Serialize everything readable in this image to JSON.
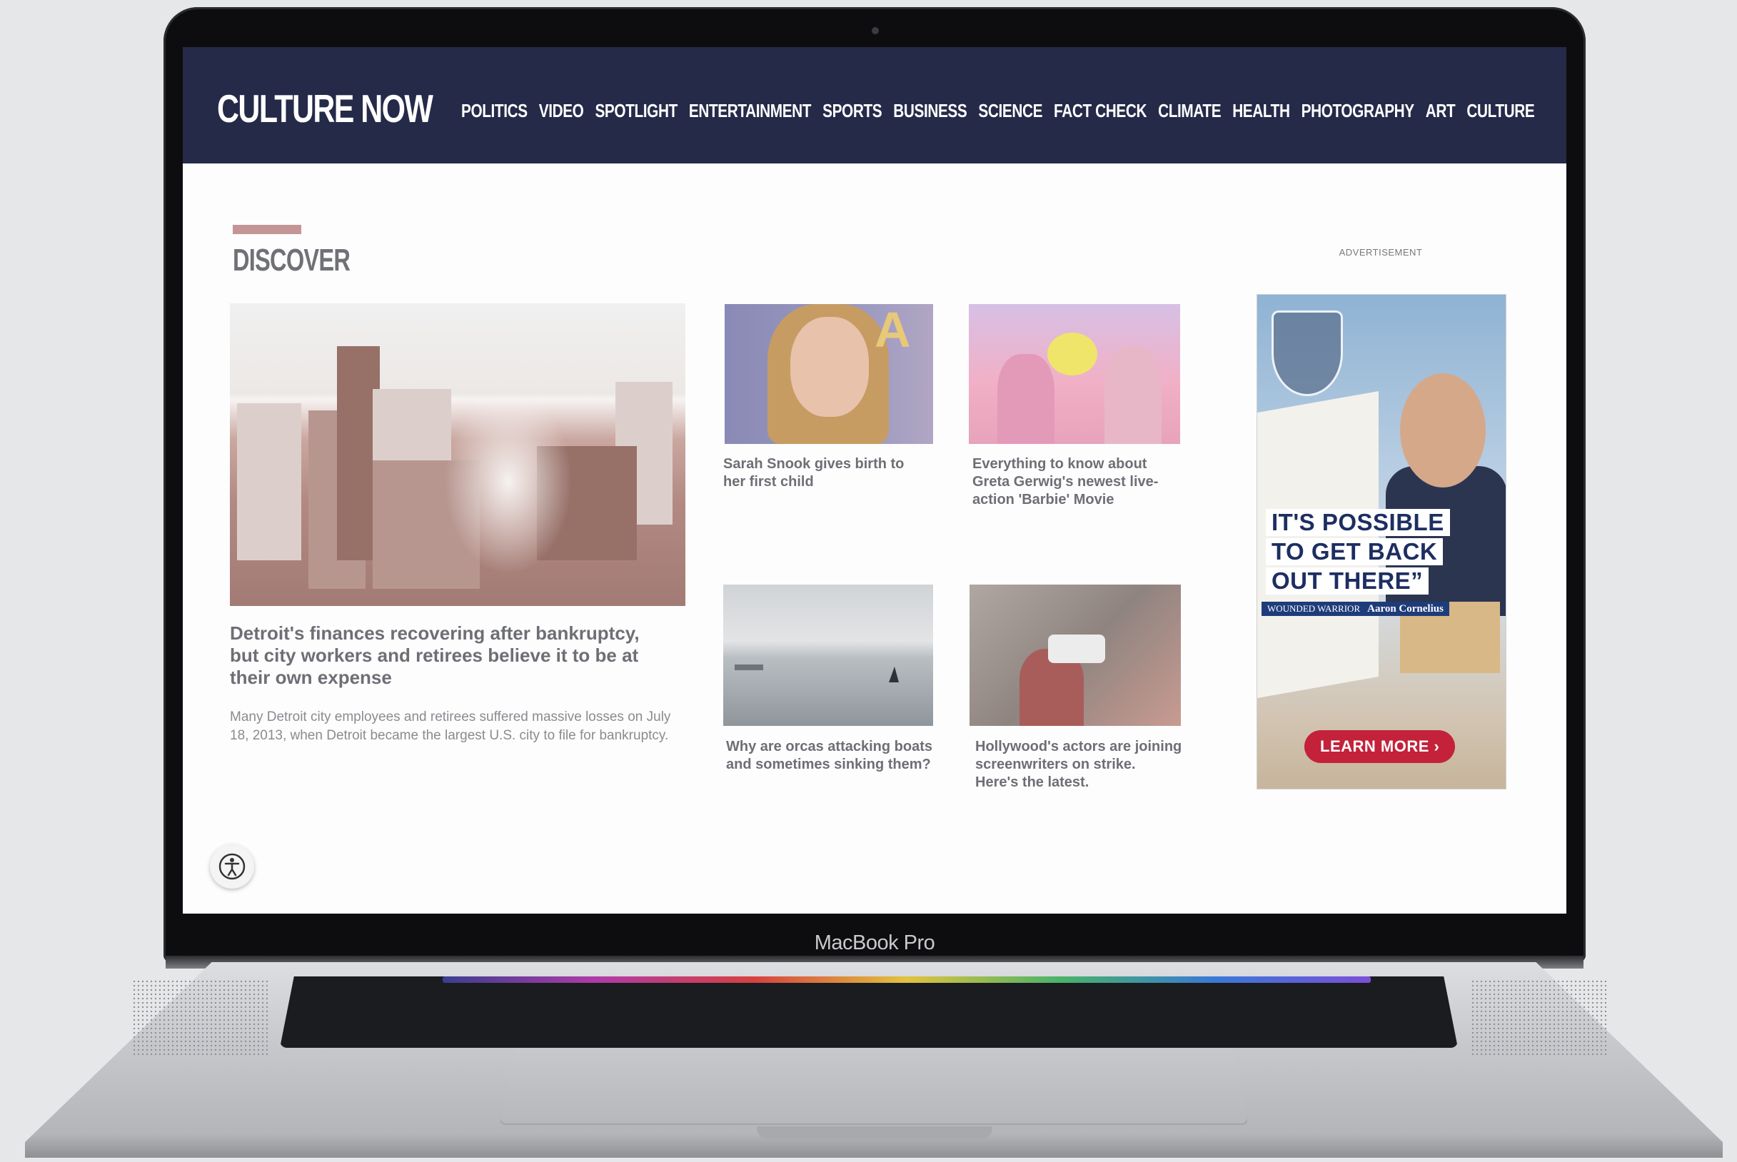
{
  "device": {
    "label": "MacBook Pro"
  },
  "site": {
    "logo": "CULTURE NOW",
    "nav": [
      "POLITICS",
      "VIDEO",
      "SPOTLIGHT",
      "ENTERTAINMENT",
      "SPORTS",
      "BUSINESS",
      "SCIENCE",
      "FACT CHECK",
      "CLIMATE",
      "HEALTH",
      "PHOTOGRAPHY",
      "ART",
      "CULTURE"
    ],
    "colors": {
      "header": "#252a49",
      "accent": "#c49595",
      "ad_button": "#c3223a"
    }
  },
  "discover": {
    "title": "DISCOVER",
    "feature": {
      "headline": "Detroit's finances recovering after bankruptcy, but city workers and retirees believe it to be at their own expense",
      "summary": "Many Detroit city employees and retirees suffered massive losses on July 18, 2013, when Detroit became the largest U.S. city to file for bankruptcy."
    },
    "cards": [
      {
        "title": "Sarah Snook gives birth to her first child"
      },
      {
        "title": "Everything to know about Greta Gerwig's newest live-action 'Barbie' Movie"
      },
      {
        "title": "Why are orcas attacking boats and sometimes sinking them?"
      },
      {
        "title": "Hollywood's actors are joining screenwriters on strike. Here's the latest."
      }
    ]
  },
  "ad": {
    "label": "ADVERTISEMENT",
    "lines": [
      "IT'S POSSIBLE",
      "TO GET BACK",
      "OUT THERE”"
    ],
    "brand_left": "WOUNDED WARRIOR",
    "brand_right": "Aaron Cornelius",
    "cta": "LEARN MORE ›"
  },
  "icons": {
    "accessibility": "accessibility-icon"
  }
}
